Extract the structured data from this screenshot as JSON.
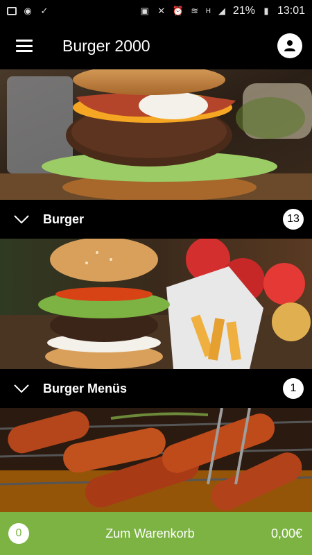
{
  "status_bar": {
    "battery": "21%",
    "time": "13:01",
    "network": "H"
  },
  "app": {
    "title": "Burger 2000"
  },
  "categories": [
    {
      "label": "Burger",
      "count": "13",
      "image": "burger-photo"
    },
    {
      "label": "Burger Menüs",
      "count": "1",
      "image": "burger-fries-photo"
    },
    {
      "label": "",
      "count": "",
      "image": "grilled-sausages-photo"
    }
  ],
  "cart": {
    "count": "0",
    "label": "Zum Warenkorb",
    "total": "0,00€"
  },
  "colors": {
    "accent": "#7cb342",
    "background": "#000000"
  }
}
